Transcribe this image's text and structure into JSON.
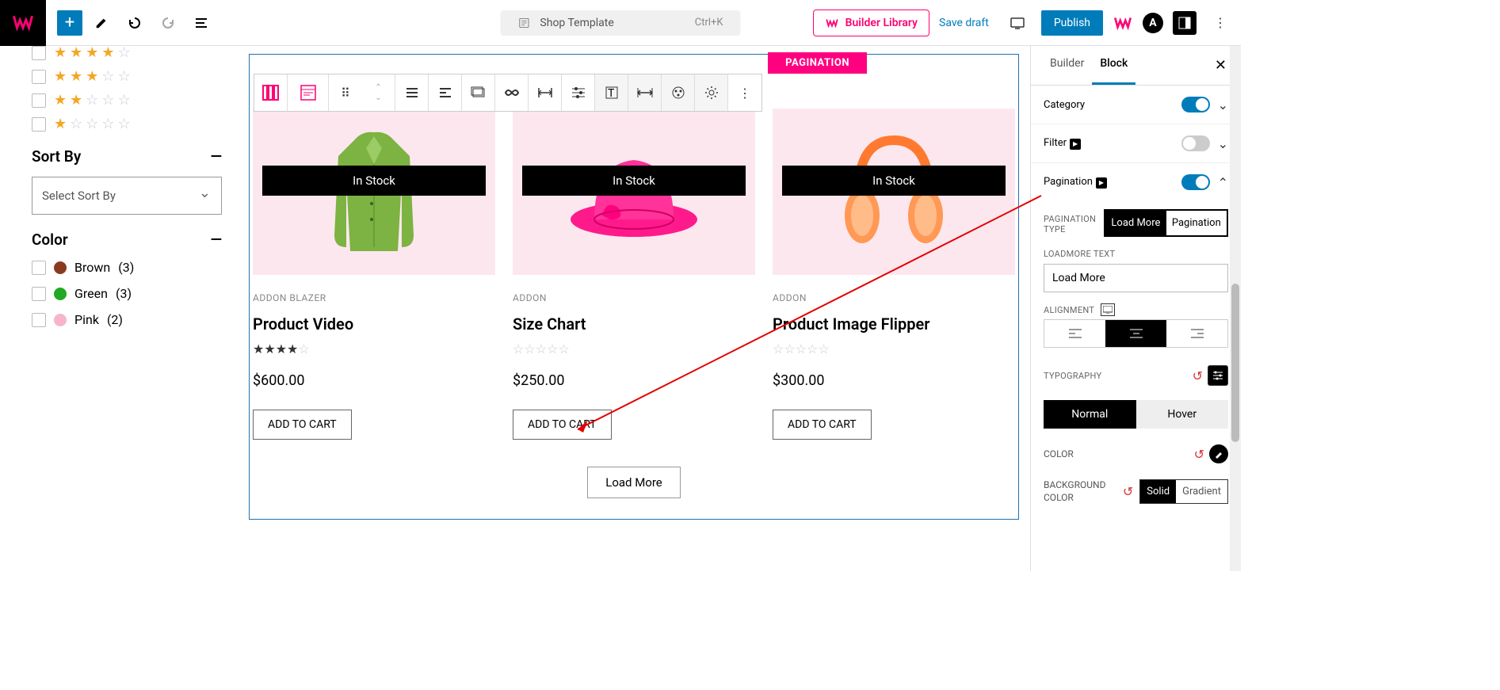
{
  "header": {
    "template_name": "Shop Template",
    "shortcut": "Ctrl+K",
    "builder_library": "Builder Library",
    "save_draft": "Save draft",
    "publish": "Publish"
  },
  "sidebar": {
    "sort_by_label": "Sort By",
    "sort_placeholder": "Select Sort By",
    "color_label": "Color",
    "colors": [
      {
        "name": "Brown",
        "count": "(3)",
        "hex": "#8B3A20"
      },
      {
        "name": "Green",
        "count": "(3)",
        "hex": "#22A822"
      },
      {
        "name": "Pink",
        "count": "(2)",
        "hex": "#F7B5C9"
      }
    ]
  },
  "canvas": {
    "pagination_chip": "PAGINATION",
    "products": [
      {
        "stock": "In Stock",
        "category": "ADDON  BLAZER",
        "title": "Product Video",
        "price": "$600.00",
        "add": "ADD TO CART",
        "rating": 4
      },
      {
        "stock": "In Stock",
        "category": "ADDON",
        "title": "Size Chart",
        "price": "$250.00",
        "add": "ADD TO CART",
        "rating": 0
      },
      {
        "stock": "In Stock",
        "category": "ADDON",
        "title": "Product Image Flipper",
        "price": "$300.00",
        "add": "ADD TO CART",
        "rating": 0
      }
    ],
    "load_more": "Load More"
  },
  "panel": {
    "tabs": [
      "Builder",
      "Block"
    ],
    "category_label": "Category",
    "filter_label": "Filter",
    "pagination_label": "Pagination",
    "pag_type_label": "PAGINATION TYPE",
    "pag_type_options": [
      "Load More",
      "Pagination"
    ],
    "loadmore_text_label": "LOADMORE TEXT",
    "loadmore_text_value": "Load More",
    "alignment_label": "ALIGNMENT",
    "typography_label": "TYPOGRAPHY",
    "state_tabs": [
      "Normal",
      "Hover"
    ],
    "color_label": "COLOR",
    "bg_color_label": "BACKGROUND COLOR",
    "bg_options": [
      "Solid",
      "Gradient"
    ]
  }
}
